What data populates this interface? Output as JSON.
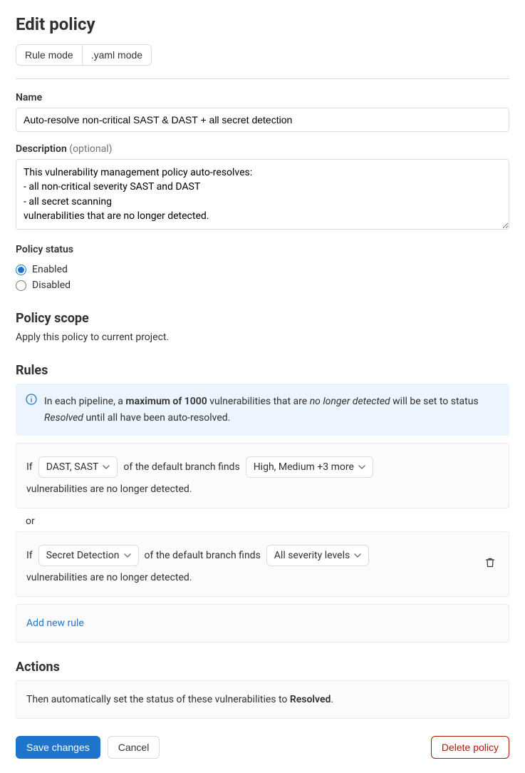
{
  "header": {
    "title": "Edit policy"
  },
  "modes": {
    "rule": "Rule mode",
    "yaml": ".yaml mode"
  },
  "name": {
    "label": "Name",
    "value": "Auto-resolve non-critical SAST & DAST + all secret detection"
  },
  "description": {
    "label": "Description",
    "optional": "(optional)",
    "value": "This vulnerability management policy auto-resolves:\n- all non-critical severity SAST and DAST\n- all secret scanning\nvulnerabilities that are no longer detected."
  },
  "policy_status": {
    "label": "Policy status",
    "enabled": "Enabled",
    "disabled": "Disabled",
    "selected": "enabled"
  },
  "policy_scope": {
    "heading": "Policy scope",
    "text": "Apply this policy to current project."
  },
  "rules": {
    "heading": "Rules",
    "info_prefix": "In each pipeline, a ",
    "info_bold": "maximum of 1000",
    "info_mid": " vulnerabilities that are ",
    "info_italic1": "no longer detected",
    "info_mid2": " will be set to status ",
    "info_italic2": "Resolved",
    "info_suffix": " until all have been auto-resolved.",
    "if_label": "If",
    "branch_text": "of the default branch finds",
    "suffix_text": "vulnerabilities are no longer detected.",
    "or_label": "or",
    "rule1": {
      "scanner": "DAST, SAST",
      "severity": "High, Medium +3 more"
    },
    "rule2": {
      "scanner": "Secret Detection",
      "severity": "All severity levels"
    },
    "add_new": "Add new rule"
  },
  "actions": {
    "heading": "Actions",
    "text_prefix": "Then automatically set the status of these vulnerabilities to ",
    "text_bold": "Resolved",
    "text_suffix": "."
  },
  "buttons": {
    "save": "Save changes",
    "cancel": "Cancel",
    "delete": "Delete policy"
  }
}
